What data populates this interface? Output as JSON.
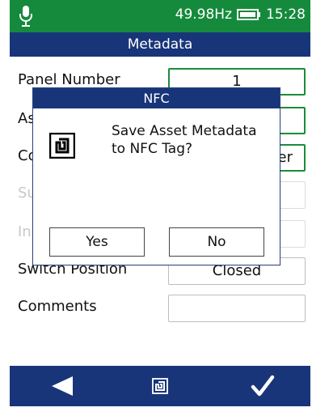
{
  "status": {
    "frequency": "49.98Hz",
    "time": "15:28",
    "icons": [
      "microphone-icon",
      "battery-icon"
    ]
  },
  "title": "Metadata",
  "form": {
    "rows": [
      {
        "label": "Panel Number",
        "value": "1"
      },
      {
        "label": "As",
        "value": ""
      },
      {
        "label": "Co",
        "value": "er"
      },
      {
        "label": "Su",
        "value": ""
      },
      {
        "label": "In",
        "value": ""
      },
      {
        "label": "Switch Position",
        "value": "Closed"
      },
      {
        "label": "Comments",
        "value": ""
      }
    ]
  },
  "dialog": {
    "title": "NFC",
    "icon": "nfc-tag-icon",
    "message": "Save Asset Metadata\nto NFC Tag?",
    "yes_label": "Yes",
    "no_label": "No"
  },
  "bottom_bar": {
    "icons": [
      "back-arrow-icon",
      "nfc-icon",
      "checkmark-icon"
    ]
  },
  "colors": {
    "status_green": "#158a3c",
    "navy": "#18357a",
    "field_green_border": "#1b8c3a"
  }
}
